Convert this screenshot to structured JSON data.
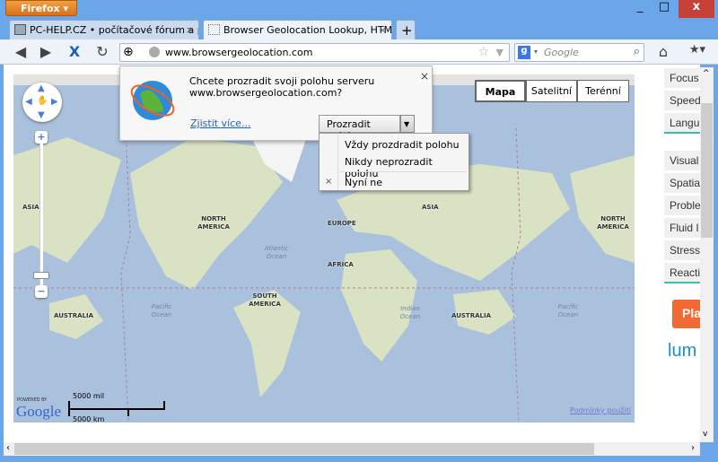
{
  "browser": {
    "menu_button": "Firefox",
    "minimize": "_",
    "maximize": "□",
    "close": "x"
  },
  "tabs": [
    {
      "label": "PC-HELP.CZ • počítačové fórum a pc...",
      "active": false
    },
    {
      "label": "Browser Geolocation Lookup, HTML ...",
      "active": true
    }
  ],
  "new_tab": "+",
  "toolbar": {
    "url": "www.browsergeolocation.com",
    "search_placeholder": "Google"
  },
  "popup": {
    "line1": "Chcete prozradit svoji polohu serveru",
    "line2": "www.browsergeolocation.com?",
    "learn_more": "Zjistit více...",
    "share_button": "Prozradit polohu",
    "close": "×"
  },
  "menu": {
    "items": [
      {
        "label": "Vždy prozdradit polohu"
      },
      {
        "label": "Nikdy neprozradit polohu"
      },
      {
        "label": "Nyní ne",
        "icon": "close-icon"
      }
    ]
  },
  "map": {
    "types": [
      "Mapa",
      "Satelitní",
      "Terénní"
    ],
    "selected": "Mapa",
    "labels": {
      "asia_left": "ASIA",
      "north_america": "NORTH AMERICA",
      "europe": "EUROPE",
      "asia": "ASIA",
      "africa": "AFRICA",
      "south_america": "SOUTH AMERICA",
      "australia_left": "AUSTRALIA",
      "australia": "AUSTRALIA",
      "north_america_right": "NORTH AMERICA"
    },
    "oceans": {
      "atlantic": "Atlantic Ocean",
      "pacific_left": "Pacific Ocean",
      "indian": "Indian Ocean",
      "pacific_right": "Pacific Ocean"
    },
    "scale_mi": "5000 mil",
    "scale_km": "5000 km",
    "powered_by": "POWERED BY",
    "logo": "Google",
    "terms": "Podmínky použití",
    "colors": {
      "water": "#a9c1dd",
      "land": "#d9e3c4"
    }
  },
  "right_panel": {
    "group1": [
      "Focus",
      "Speed",
      "Langu"
    ],
    "group2": [
      "Visual",
      "Spatia",
      "Proble",
      "Fluid I",
      "Stress",
      "Reacti"
    ],
    "play_button": "Pla",
    "brand": "lum",
    "accent": "#3cbfae",
    "button_color": "#f26a33"
  }
}
